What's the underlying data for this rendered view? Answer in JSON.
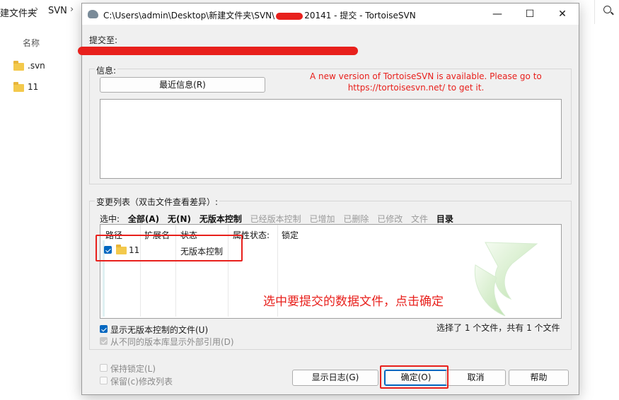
{
  "explorer": {
    "breadcrumb": [
      "建文件夹",
      "SVN"
    ],
    "column_header": "名称",
    "items": [
      ".svn",
      "11"
    ]
  },
  "dialog": {
    "title": "C:\\Users\\admin\\Desktop\\新建文件夹\\SVN\\",
    "title_suffix": "20141 - 提交 - TortoiseSVN",
    "commit_to_label": "提交至:",
    "message_label": "信息:",
    "recent_messages_button": "最近信息(R)",
    "update_notice_line1": "A new version of TortoiseSVN is available. Please go to",
    "update_notice_line2": "https://tortoisesvn.net/ to get it.",
    "changes_label": "变更列表（双击文件查看差异）:",
    "select_label": "选中:",
    "filters": [
      {
        "label": "全部(A)",
        "enabled": true
      },
      {
        "label": "无(N)",
        "enabled": true
      },
      {
        "label": "无版本控制",
        "enabled": true
      },
      {
        "label": "已经版本控制",
        "enabled": false
      },
      {
        "label": "已增加",
        "enabled": false
      },
      {
        "label": "已删除",
        "enabled": false
      },
      {
        "label": "已修改",
        "enabled": false
      },
      {
        "label": "文件",
        "enabled": false
      },
      {
        "label": "目录",
        "enabled": true
      }
    ],
    "columns": [
      "路径",
      "扩展名",
      "状态",
      "属性状态:",
      "锁定"
    ],
    "rows": [
      {
        "checked": true,
        "path": "11",
        "ext": "",
        "status": "无版本控制"
      }
    ],
    "show_unversioned": "显示无版本控制的文件(U)",
    "show_externals": "从不同的版本库显示外部引用(D)",
    "selection_summary": "选择了 1 个文件，共有 1 个文件",
    "keep_locks": "保持锁定(L)",
    "keep_changelist": "保留(c)修改列表",
    "buttons": {
      "show_log": "显示日志(G)",
      "ok": "确定(O)",
      "cancel": "取消",
      "help": "帮助"
    },
    "annotation": "选中要提交的数据文件，点击确定"
  },
  "window_controls": {
    "minimize": "—",
    "maximize": "☐",
    "close": "✕"
  },
  "colors": {
    "annotation_red": "#e8201c",
    "accent": "#0067c0"
  }
}
